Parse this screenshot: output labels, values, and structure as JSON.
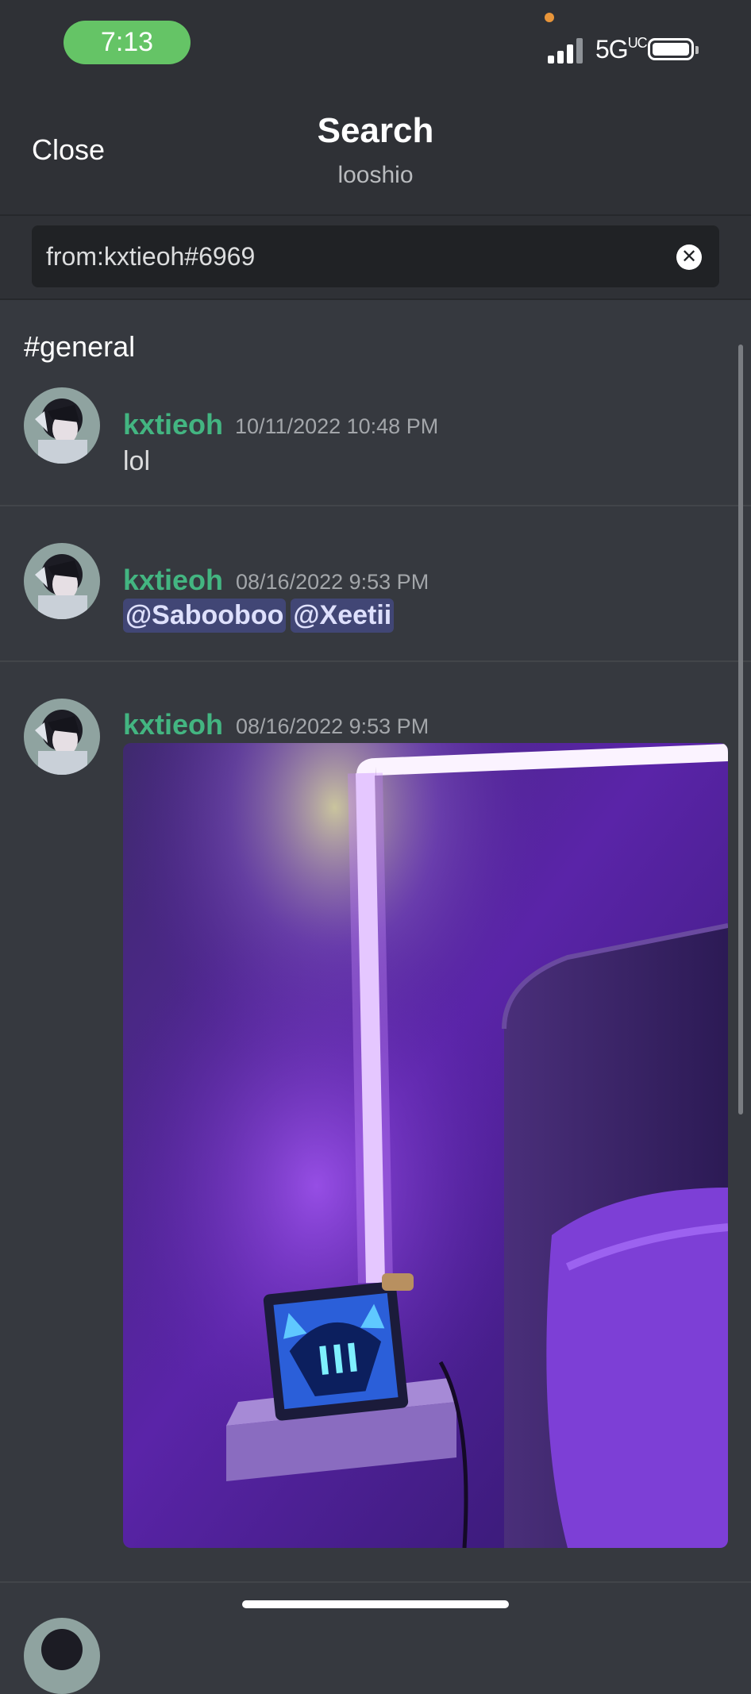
{
  "status_bar": {
    "time": "7:13",
    "network": "5G",
    "network_suffix": "UC",
    "signal_icon": "cellular-signal-icon",
    "battery_icon": "battery-full-icon"
  },
  "header": {
    "close_label": "Close",
    "title": "Search",
    "subtitle": "looshio"
  },
  "search": {
    "query": "from:kxtieoh#6969",
    "clear_icon": "clear-circle-icon"
  },
  "results": {
    "channel": "#general",
    "messages": [
      {
        "author": "kxtieoh",
        "timestamp": "10/11/2022 10:48 PM",
        "text": "lol"
      },
      {
        "author": "kxtieoh",
        "timestamp": "08/16/2022 9:53 PM",
        "mentions": [
          "@Sabooboo",
          "@Xeetii"
        ]
      },
      {
        "author": "kxtieoh",
        "timestamp": "08/16/2022 9:53 PM",
        "attachment": "image-attachment"
      }
    ]
  },
  "colors": {
    "background": "#36393f",
    "header": "#2f3136",
    "author": "#43b581",
    "mention_bg": "#414675",
    "time_pill": "#65c466"
  }
}
